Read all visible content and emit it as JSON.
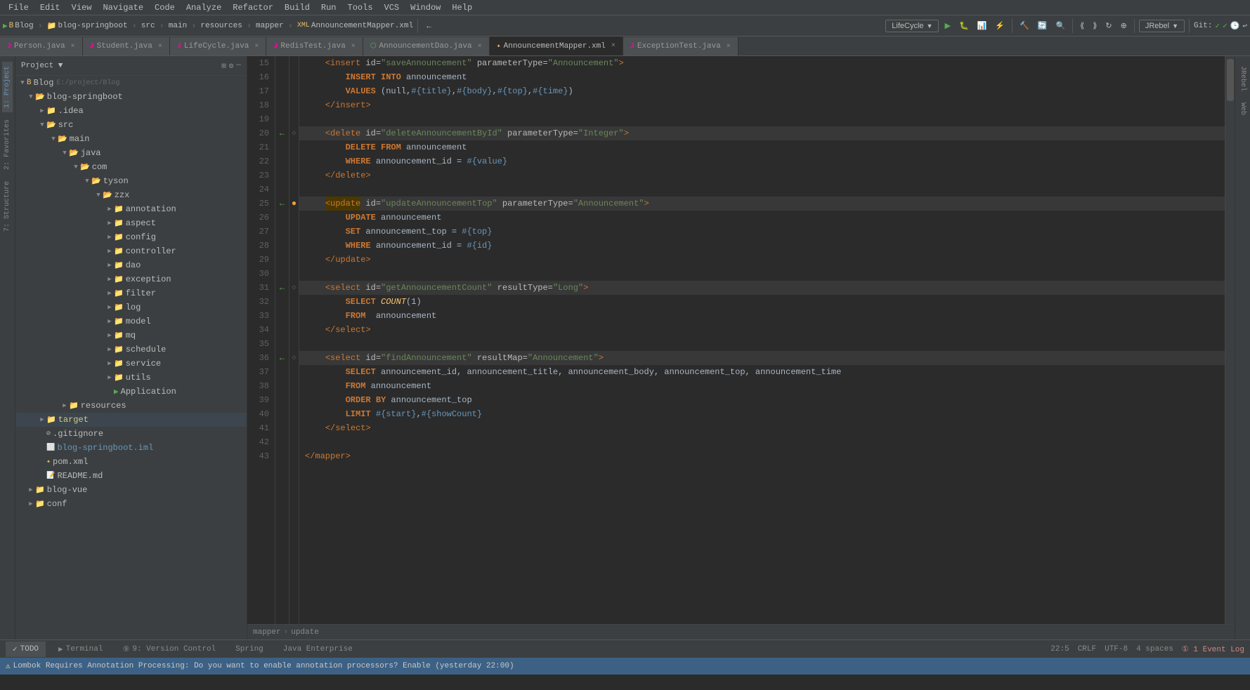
{
  "menu": {
    "items": [
      "File",
      "Edit",
      "View",
      "Navigate",
      "Code",
      "Analyze",
      "Refactor",
      "Build",
      "Run",
      "Tools",
      "VCS",
      "Window",
      "Help"
    ]
  },
  "toolbar": {
    "breadcrumb": [
      "Blog",
      "blog-springboot",
      "src",
      "main",
      "resources",
      "mapper",
      "AnnouncementMapper.xml"
    ],
    "lifecycle_label": "LifeCycle",
    "jrebel_label": "JRebel",
    "git_label": "Git:"
  },
  "tabs": [
    {
      "id": "person",
      "label": "Person.java",
      "type": "java",
      "active": false
    },
    {
      "id": "student",
      "label": "Student.java",
      "type": "java",
      "active": false
    },
    {
      "id": "lifecycle",
      "label": "LifeCycle.java",
      "type": "java",
      "active": false
    },
    {
      "id": "redis",
      "label": "RedisTest.java",
      "type": "java",
      "active": false
    },
    {
      "id": "anndao",
      "label": "AnnouncementDao.java",
      "type": "java",
      "active": false
    },
    {
      "id": "annmapper",
      "label": "AnnouncementMapper.xml",
      "type": "xml",
      "active": true
    },
    {
      "id": "extest",
      "label": "ExceptionTest.java",
      "type": "java",
      "active": false
    }
  ],
  "project_tree": {
    "root_label": "Project",
    "items": [
      {
        "level": 0,
        "label": "Blog",
        "path": "E:/project/Blog",
        "type": "root",
        "expanded": true
      },
      {
        "level": 1,
        "label": "blog-springboot",
        "type": "folder",
        "expanded": true
      },
      {
        "level": 2,
        "label": ".idea",
        "type": "folder",
        "expanded": false
      },
      {
        "level": 2,
        "label": "src",
        "type": "folder",
        "expanded": true
      },
      {
        "level": 3,
        "label": "main",
        "type": "folder",
        "expanded": true
      },
      {
        "level": 4,
        "label": "java",
        "type": "folder",
        "expanded": true
      },
      {
        "level": 5,
        "label": "com",
        "type": "folder",
        "expanded": true
      },
      {
        "level": 6,
        "label": "tyson",
        "type": "folder",
        "expanded": true
      },
      {
        "level": 7,
        "label": "zzx",
        "type": "folder",
        "expanded": true
      },
      {
        "level": 8,
        "label": "annotation",
        "type": "folder",
        "expanded": false
      },
      {
        "level": 8,
        "label": "aspect",
        "type": "folder",
        "expanded": false
      },
      {
        "level": 8,
        "label": "config",
        "type": "folder",
        "expanded": false
      },
      {
        "level": 8,
        "label": "controller",
        "type": "folder",
        "expanded": false
      },
      {
        "level": 8,
        "label": "dao",
        "type": "folder",
        "expanded": false
      },
      {
        "level": 8,
        "label": "exception",
        "type": "folder",
        "expanded": false
      },
      {
        "level": 8,
        "label": "filter",
        "type": "folder",
        "expanded": false
      },
      {
        "level": 8,
        "label": "log",
        "type": "folder",
        "expanded": false
      },
      {
        "level": 8,
        "label": "model",
        "type": "folder",
        "expanded": false
      },
      {
        "level": 8,
        "label": "mq",
        "type": "folder",
        "expanded": false
      },
      {
        "level": 8,
        "label": "schedule",
        "type": "folder",
        "expanded": false
      },
      {
        "level": 8,
        "label": "service",
        "type": "folder",
        "expanded": false
      },
      {
        "level": 8,
        "label": "utils",
        "type": "folder",
        "expanded": false
      },
      {
        "level": 8,
        "label": "Application",
        "type": "java",
        "expanded": false
      },
      {
        "level": 3,
        "label": "resources",
        "type": "folder",
        "expanded": false
      },
      {
        "level": 1,
        "label": "target",
        "type": "folder",
        "expanded": false,
        "highlighted": true
      },
      {
        "level": 1,
        "label": ".gitignore",
        "type": "gitignore"
      },
      {
        "level": 1,
        "label": "blog-springboot.iml",
        "type": "iml"
      },
      {
        "level": 1,
        "label": "pom.xml",
        "type": "pom"
      },
      {
        "level": 1,
        "label": "README.md",
        "type": "md"
      },
      {
        "level": 0,
        "label": "blog-vue",
        "type": "folder",
        "expanded": false
      },
      {
        "level": 0,
        "label": "conf",
        "type": "folder",
        "expanded": false
      }
    ]
  },
  "code_lines": [
    {
      "num": 15,
      "gutter": "",
      "content": "    <insert id=\"saveAnnouncement\" parameterType=\"Announcement\">"
    },
    {
      "num": 16,
      "gutter": "",
      "content": "        INSERT INTO announcement"
    },
    {
      "num": 17,
      "gutter": "",
      "content": "        VALUES (null,#{title},#{body},#{top},#{time})"
    },
    {
      "num": 18,
      "gutter": "",
      "content": "    </insert>"
    },
    {
      "num": 19,
      "gutter": "",
      "content": ""
    },
    {
      "num": 20,
      "gutter": "arrow",
      "content": "    <delete id=\"deleteAnnouncementById\" parameterType=\"Integer\">"
    },
    {
      "num": 21,
      "gutter": "",
      "content": "        DELETE FROM announcement"
    },
    {
      "num": 22,
      "gutter": "",
      "content": "        WHERE announcement_id = #{value}"
    },
    {
      "num": 23,
      "gutter": "",
      "content": "    </delete>"
    },
    {
      "num": 24,
      "gutter": "",
      "content": ""
    },
    {
      "num": 25,
      "gutter": "arrow-dot",
      "content": "    <update id=\"updateAnnouncementTop\" parameterType=\"Announcement\">"
    },
    {
      "num": 26,
      "gutter": "",
      "content": "        UPDATE announcement"
    },
    {
      "num": 27,
      "gutter": "",
      "content": "        SET announcement_top = #{top}"
    },
    {
      "num": 28,
      "gutter": "",
      "content": "        WHERE announcement_id = #{id}"
    },
    {
      "num": 29,
      "gutter": "",
      "content": "    </update>"
    },
    {
      "num": 30,
      "gutter": "",
      "content": ""
    },
    {
      "num": 31,
      "gutter": "arrow",
      "content": "    <select id=\"getAnnouncementCount\" resultType=\"Long\">"
    },
    {
      "num": 32,
      "gutter": "",
      "content": "        SELECT COUNT(1)"
    },
    {
      "num": 33,
      "gutter": "",
      "content": "        FROM  announcement"
    },
    {
      "num": 34,
      "gutter": "",
      "content": "    </select>"
    },
    {
      "num": 35,
      "gutter": "",
      "content": ""
    },
    {
      "num": 36,
      "gutter": "arrow",
      "content": "    <select id=\"findAnnouncement\" resultMap=\"Announcement\">"
    },
    {
      "num": 37,
      "gutter": "",
      "content": "        SELECT announcement_id, announcement_title, announcement_body, announcement_top, announcement_time"
    },
    {
      "num": 38,
      "gutter": "",
      "content": "        FROM announcement"
    },
    {
      "num": 39,
      "gutter": "",
      "content": "        ORDER BY announcement_top"
    },
    {
      "num": 40,
      "gutter": "",
      "content": "        LIMIT #{start},#{showCount}"
    },
    {
      "num": 41,
      "gutter": "",
      "content": "    </select>"
    },
    {
      "num": 42,
      "gutter": "",
      "content": ""
    },
    {
      "num": 43,
      "gutter": "",
      "content": "</mapper>"
    }
  ],
  "bottom_tabs": [
    {
      "id": "todo",
      "label": "TODO",
      "icon": "✓"
    },
    {
      "id": "terminal",
      "label": "Terminal",
      "icon": "▶"
    },
    {
      "id": "version",
      "label": "9: Version Control",
      "icon": ""
    },
    {
      "id": "spring",
      "label": "Spring",
      "icon": ""
    },
    {
      "id": "java-enterprise",
      "label": "Java Enterprise",
      "icon": ""
    }
  ],
  "editor_breadcrumb": [
    "mapper",
    "update"
  ],
  "status_bar": {
    "warning": "Lombok Requires Annotation Processing: Do you want to enable annotation processors? Enable (yesterday 22:00)",
    "position": "22:5",
    "encoding": "CRLF",
    "indent": "UTF-8",
    "spaces": "4 spaces"
  },
  "status_right": {
    "position": "22:5",
    "line_sep": "CRLF",
    "encoding": "UTF-8",
    "indent": "4 spaces",
    "event_log": "1 Event Log"
  },
  "left_panels": [
    "1: Project",
    "2: Favorites",
    "7: Structure"
  ],
  "right_panels": [
    "JRebel",
    "Web"
  ]
}
